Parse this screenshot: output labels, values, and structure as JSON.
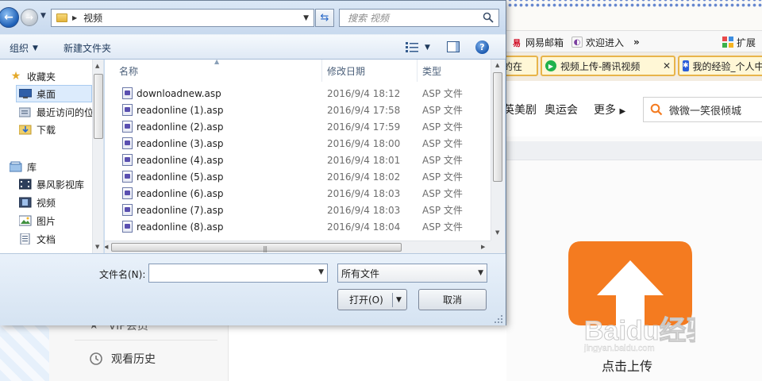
{
  "dialog": {
    "address": {
      "path": "视频"
    },
    "search": {
      "placeholder": "搜索 视频"
    },
    "toolbar": {
      "organize": "组织",
      "new_folder": "新建文件夹"
    },
    "nav": {
      "items": [
        {
          "label": "收藏夹",
          "icon": "star-icon"
        },
        {
          "label": "桌面",
          "icon": "desktop-icon",
          "selected": true
        },
        {
          "label": "最近访问的位",
          "icon": "recent-places-icon"
        },
        {
          "label": "下载",
          "icon": "download-folder-icon"
        },
        {
          "label": "库",
          "icon": "library-icon"
        },
        {
          "label": "暴风影视库",
          "icon": "video-library-icon"
        },
        {
          "label": "视频",
          "icon": "video-folder-icon"
        },
        {
          "label": "图片",
          "icon": "picture-folder-icon"
        },
        {
          "label": "文档",
          "icon": "document-folder-icon"
        }
      ]
    },
    "columns": {
      "name": "名称",
      "date": "修改日期",
      "type": "类型"
    },
    "files": [
      {
        "name": "downloadnew.asp",
        "date": "2016/9/4 18:12",
        "type": "ASP 文件"
      },
      {
        "name": "readonline (1).asp",
        "date": "2016/9/4 17:58",
        "type": "ASP 文件"
      },
      {
        "name": "readonline (2).asp",
        "date": "2016/9/4 17:59",
        "type": "ASP 文件"
      },
      {
        "name": "readonline (3).asp",
        "date": "2016/9/4 18:00",
        "type": "ASP 文件"
      },
      {
        "name": "readonline (4).asp",
        "date": "2016/9/4 18:01",
        "type": "ASP 文件"
      },
      {
        "name": "readonline (5).asp",
        "date": "2016/9/4 18:02",
        "type": "ASP 文件"
      },
      {
        "name": "readonline (6).asp",
        "date": "2016/9/4 18:03",
        "type": "ASP 文件"
      },
      {
        "name": "readonline (7).asp",
        "date": "2016/9/4 18:03",
        "type": "ASP 文件"
      },
      {
        "name": "readonline (8).asp",
        "date": "2016/9/4 18:04",
        "type": "ASP 文件"
      }
    ],
    "filename": {
      "label": "文件名(N):",
      "value": ""
    },
    "filetype": {
      "selected": "所有文件"
    },
    "buttons": {
      "open": "打开(O)",
      "cancel": "取消"
    }
  },
  "browser": {
    "favorites": [
      {
        "label": "网易邮箱",
        "icon": "netease-mail-icon"
      },
      {
        "label": "欢迎进入",
        "icon": "welcome-icon"
      }
    ],
    "more_favorites": "»",
    "extensions": "扩展",
    "tabs": [
      {
        "label": "的在"
      },
      {
        "label": "视频上传-腾讯视频"
      },
      {
        "label": "我的经验_个人中"
      }
    ],
    "nav_links": [
      "英美剧",
      "奥运会",
      "更多"
    ],
    "search_text": "微微一笑很倾城",
    "sidebar": {
      "vip": "VIP会员",
      "history": "观看历史"
    },
    "upload_label": "点击上传",
    "watermark": "Baidu经验",
    "watermark_url": "jingyan.baidu.com"
  },
  "colors": {
    "upload_orange": "#f47b20",
    "tab_border": "#e8b44a",
    "selection": "#dcebfc"
  }
}
